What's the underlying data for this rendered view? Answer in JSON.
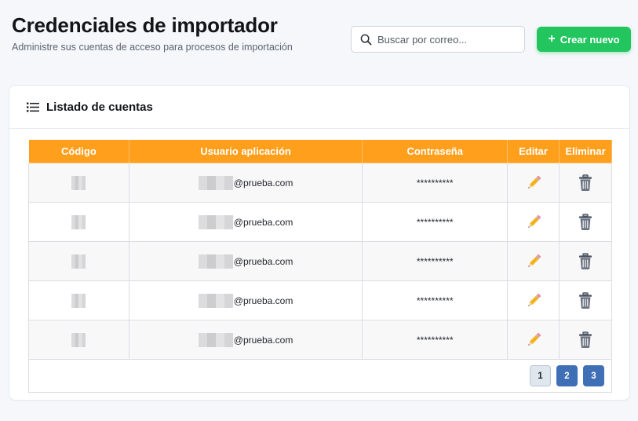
{
  "header": {
    "title": "Credenciales de importador",
    "subtitle": "Administre sus cuentas de acceso para procesos de importación"
  },
  "search": {
    "placeholder": "Buscar por correo...",
    "value": ""
  },
  "toolbar": {
    "create_label": "Crear nuevo"
  },
  "card": {
    "title": "Listado de cuentas"
  },
  "table": {
    "columns": [
      "Código",
      "Usuario aplicación",
      "Contraseña",
      "Editar",
      "Eliminar"
    ],
    "rows": [
      {
        "code": "",
        "user_suffix": "@prueba.com",
        "password": "**********"
      },
      {
        "code": "",
        "user_suffix": "@prueba.com",
        "password": "**********"
      },
      {
        "code": "",
        "user_suffix": "@prueba.com",
        "password": "**********"
      },
      {
        "code": "",
        "user_suffix": "@prueba.com",
        "password": "**********"
      },
      {
        "code": "",
        "user_suffix": "@prueba.com",
        "password": "**********"
      }
    ]
  },
  "pagination": {
    "pages": [
      "1",
      "2",
      "3"
    ],
    "current": "1"
  },
  "colors": {
    "accent_green": "#22c55e",
    "header_orange": "#ff9f1c",
    "pager_blue": "#3f6fb5"
  },
  "icons": {
    "search": "search-icon",
    "create": "plus-icon",
    "list": "list-icon",
    "edit": "pencil-icon",
    "delete": "trash-icon"
  }
}
